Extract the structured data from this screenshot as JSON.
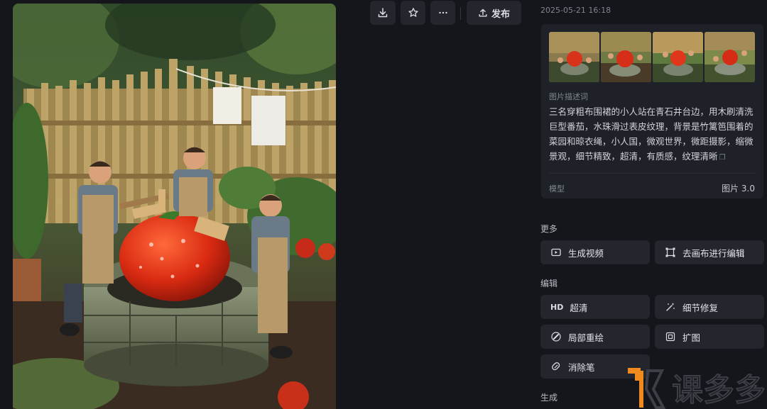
{
  "toolbar": {
    "download_icon": "download-icon",
    "favorite_icon": "star-icon",
    "more_icon": "ellipsis-icon",
    "publish_label": "发布"
  },
  "meta": {
    "timestamp": "2025-05-21 16:18"
  },
  "info": {
    "desc_label": "图片描述词",
    "description": "三名穿粗布围裙的小人站在青石井台边，用木刷清洗巨型番茄，水珠滑过表皮纹理，背景是竹篱笆围着的菜园和晾衣绳，小人国，微观世界，微距摄影，缩微景观，细节精致，超清，有质感，纹理清晰",
    "model_label": "模型",
    "model_value": "图片 3.0"
  },
  "sections": {
    "more": "更多",
    "edit": "编辑",
    "generate": "生成"
  },
  "actions": {
    "generate_video": "生成视频",
    "canvas_edit": "去画布进行编辑",
    "hd": "超清",
    "hd_icon_text": "HD",
    "detail_repair": "细节修复",
    "inpaint": "局部重绘",
    "expand": "扩图",
    "eraser": "消除笔"
  },
  "colors": {
    "background": "#14161b",
    "card": "#1e2127",
    "button": "#23262d",
    "watermark_orange": "#f08a1c"
  }
}
